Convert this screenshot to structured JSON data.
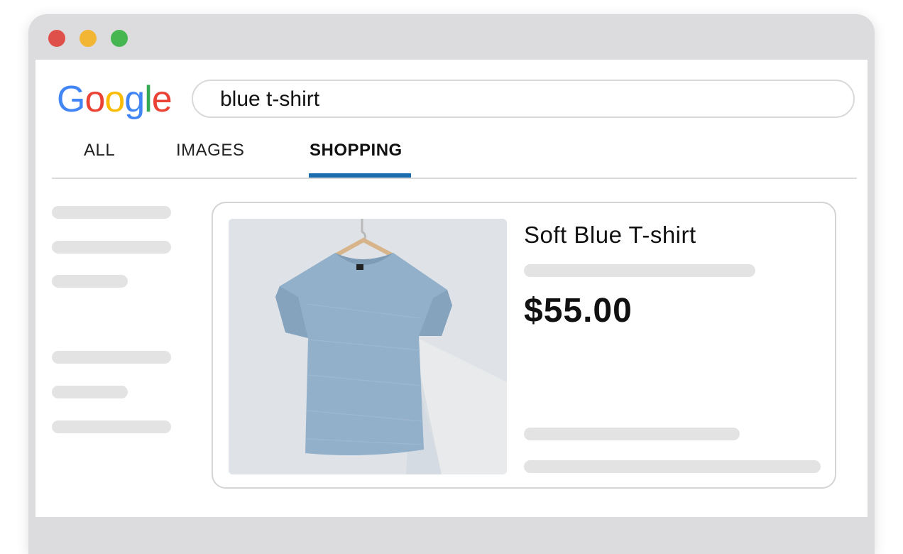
{
  "window": {
    "controls": [
      {
        "name": "close",
        "color": "#e0504a"
      },
      {
        "name": "minimize",
        "color": "#f2b534"
      },
      {
        "name": "maximize",
        "color": "#46b650"
      }
    ]
  },
  "logo": {
    "letters": [
      {
        "char": "G",
        "color": "#4285f4"
      },
      {
        "char": "o",
        "color": "#ea4335"
      },
      {
        "char": "o",
        "color": "#fbbc05"
      },
      {
        "char": "g",
        "color": "#4285f4"
      },
      {
        "char": "l",
        "color": "#34a853"
      },
      {
        "char": "e",
        "color": "#ea4335"
      }
    ]
  },
  "search": {
    "value": "blue t-shirt"
  },
  "tabs": [
    {
      "label": "ALL",
      "active": false
    },
    {
      "label": "IMAGES",
      "active": false
    },
    {
      "label": "SHOPPING",
      "active": true
    }
  ],
  "colors": {
    "accent": "#1a6eb0",
    "placeholder_bar": "#e3e3e3"
  },
  "product": {
    "title": "Soft Blue T-shirt",
    "price": "$55.00",
    "image_icon": "t-shirt-on-hanger"
  }
}
